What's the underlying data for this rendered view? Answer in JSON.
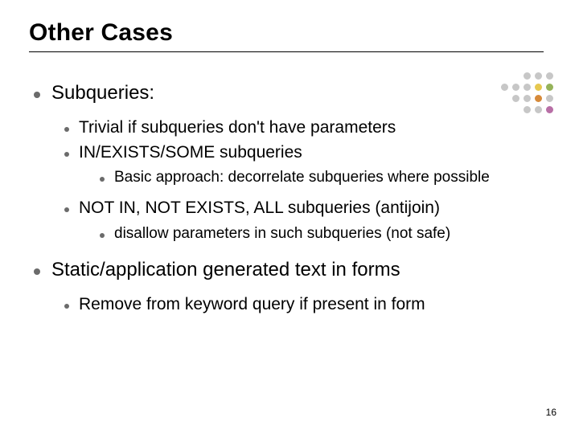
{
  "title": "Other Cases",
  "bullets": {
    "a": "Subqueries:",
    "a1": "Trivial if subqueries don't have parameters",
    "a2": "IN/EXISTS/SOME subqueries",
    "a2a": "Basic approach: decorrelate subqueries where possible",
    "a3": "NOT IN, NOT EXISTS, ALL subqueries (antijoin)",
    "a3a": "disallow parameters in such subqueries (not safe)",
    "b": "Static/application generated text in forms",
    "b1": "Remove from keyword query if present in form"
  },
  "slide_number": "16"
}
